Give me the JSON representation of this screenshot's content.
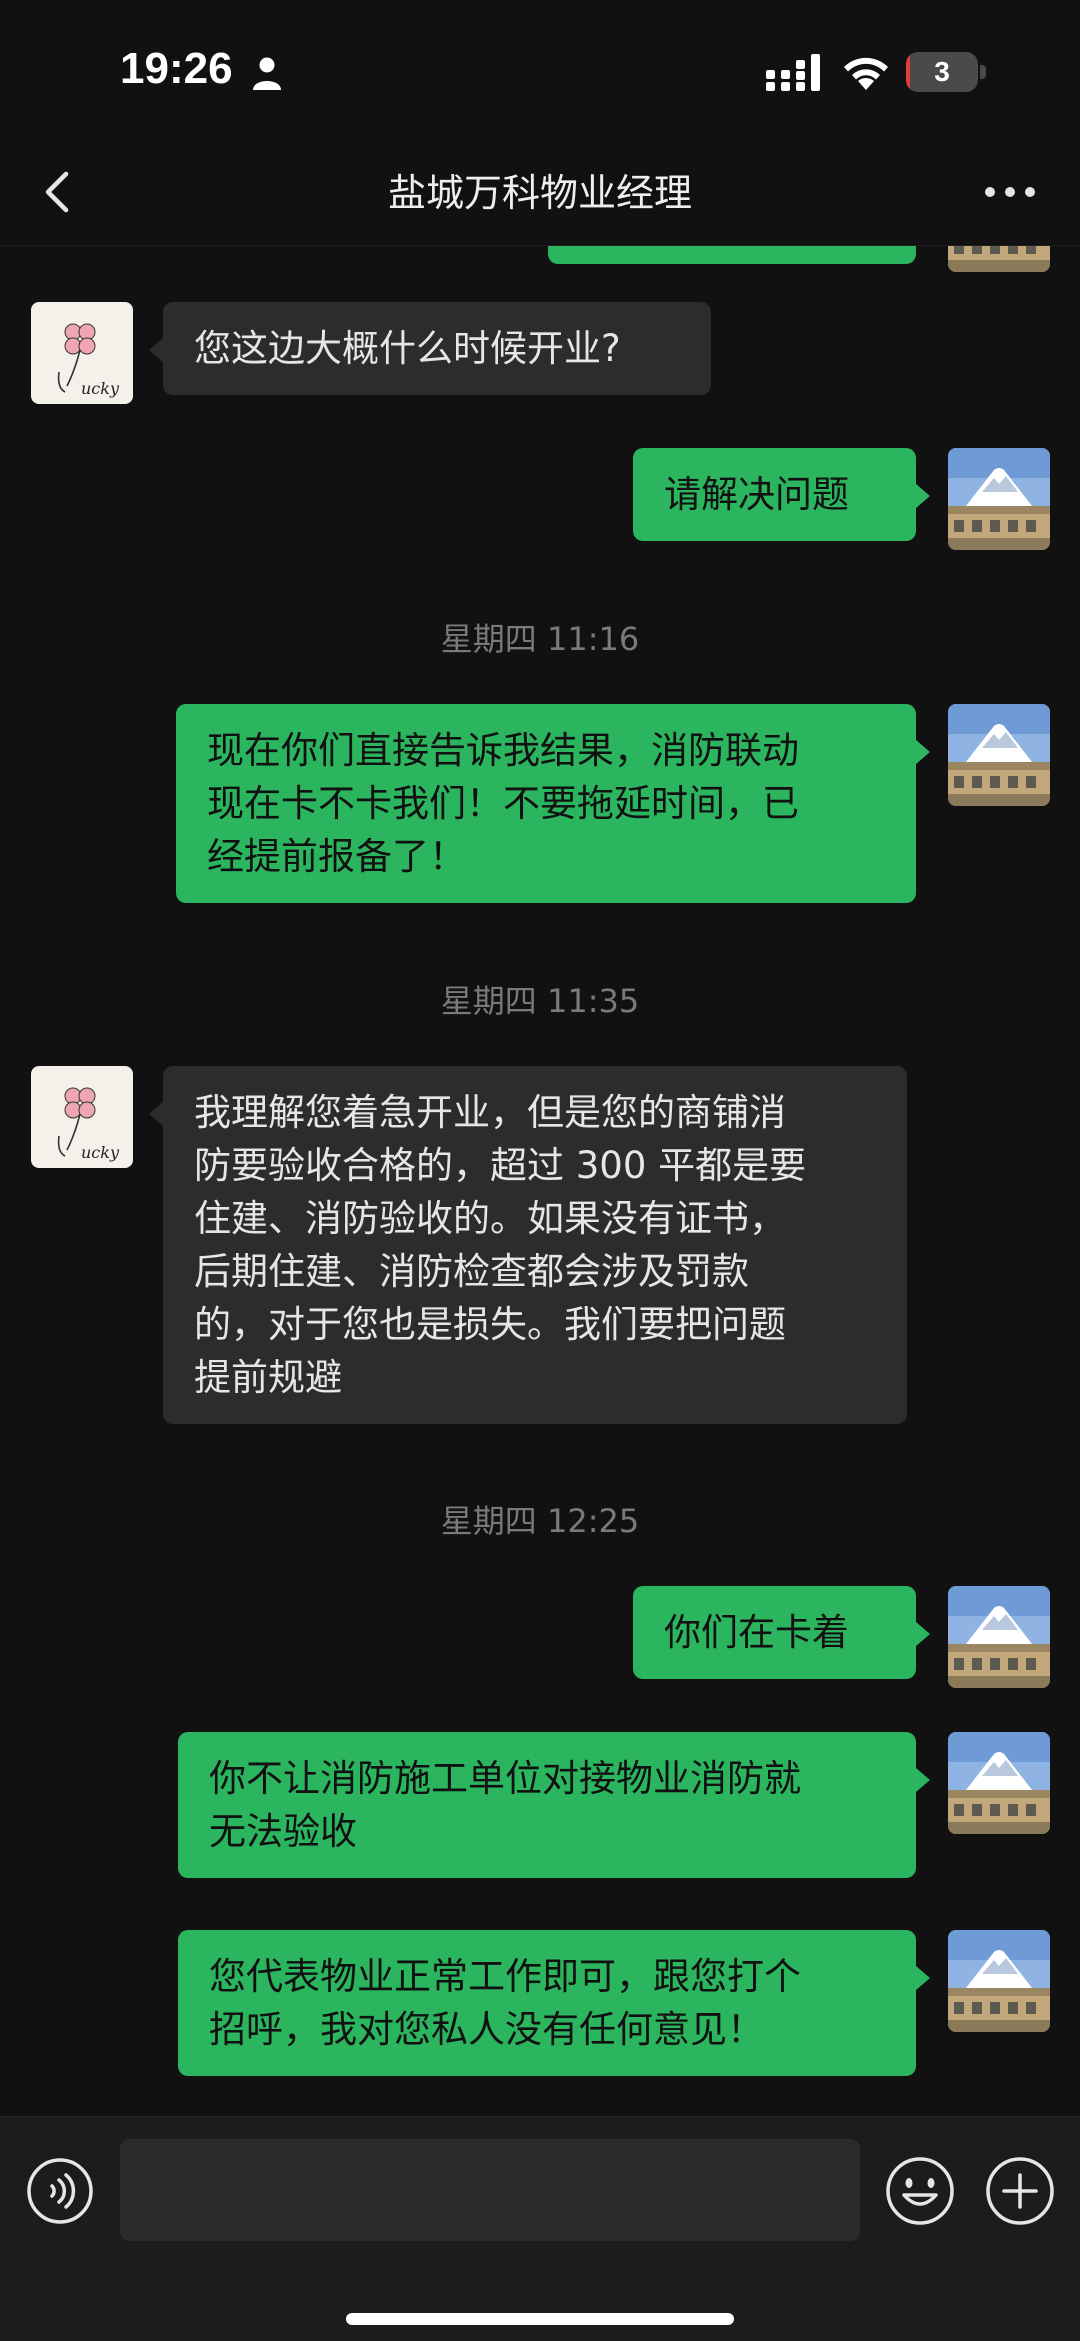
{
  "status_bar": {
    "time": "19:26",
    "battery_level": "3",
    "battery_fraction": 0.03
  },
  "header": {
    "title": "盐城万科物业经理"
  },
  "colors": {
    "outgoing_bubble": "#2bb55f",
    "incoming_bubble": "#2c2c2c",
    "background": "#111111"
  },
  "messages": [
    {
      "type": "incoming",
      "text": "您这边大概什么时候开业?"
    },
    {
      "type": "outgoing",
      "text": "请解决问题"
    },
    {
      "type": "timestamp",
      "text": "星期四 11:16"
    },
    {
      "type": "outgoing",
      "text": "现在你们直接告诉我结果，消防联动\n现在卡不卡我们！不要拖延时间，已\n经提前报备了！"
    },
    {
      "type": "timestamp",
      "text": "星期四 11:35"
    },
    {
      "type": "incoming",
      "text": "我理解您着急开业，但是您的商铺消\n防要验收合格的，超过 300 平都是要\n住建、消防验收的。如果没有证书，\n后期住建、消防检查都会涉及罚款\n的，对于您也是损失。我们要把问题\n提前规避"
    },
    {
      "type": "timestamp",
      "text": "星期四 12:25"
    },
    {
      "type": "outgoing",
      "text": "你们在卡着"
    },
    {
      "type": "outgoing",
      "text": "你不让消防施工单位对接物业消防就\n无法验收"
    },
    {
      "type": "outgoing",
      "text": "您代表物业正常工作即可，跟您打个\n招呼，我对您私人没有任何意见！"
    }
  ],
  "avatars": {
    "incoming_logo_text": "ucky"
  },
  "icons": {
    "back": "chevron-left-icon",
    "more": "more-dots-icon",
    "voice": "voice-icon",
    "emoji": "emoji-icon",
    "plus": "plus-icon"
  }
}
